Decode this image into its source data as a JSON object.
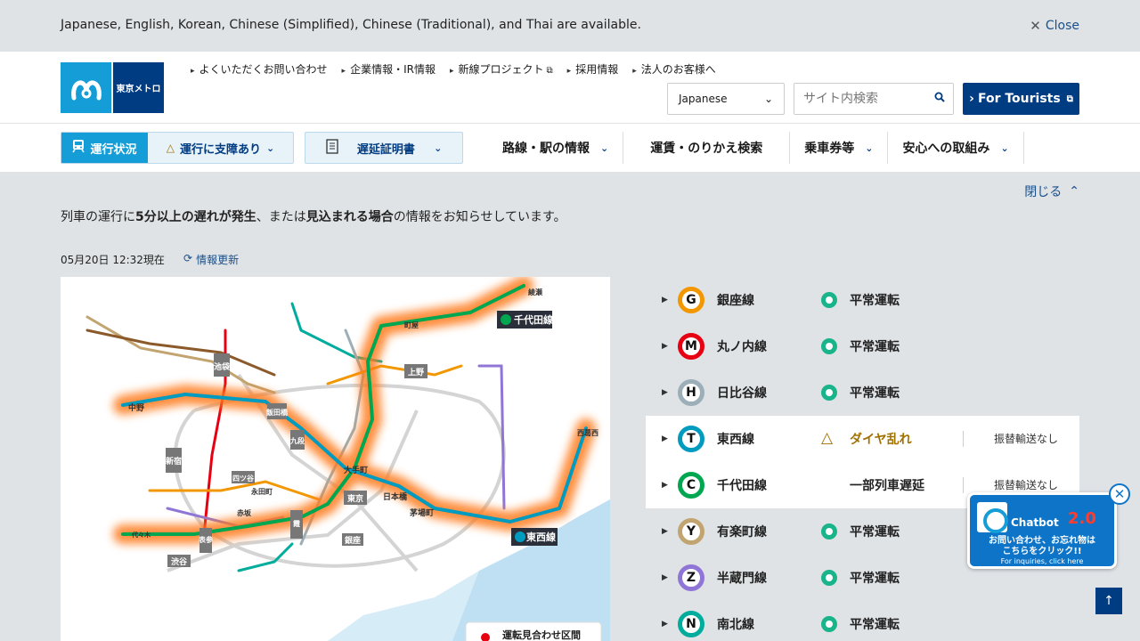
{
  "banner": {
    "message": "Japanese, English, Korean, Chinese (Simplified), Chinese (Traditional), and Thai are available.",
    "close_label": "Close"
  },
  "header": {
    "logo_text": "東京メトロ",
    "util_links": [
      "よくいただくお問い合わせ",
      "企業情報・IR情報",
      "新線プロジェクト",
      "採用情報",
      "法人のお客様へ"
    ],
    "language": "Japanese",
    "search_placeholder": "サイト内検索",
    "tourist_label": "For Tourists"
  },
  "nav": {
    "status_tag": "運行状況",
    "status_state": "運行に支障あり",
    "delay_cert": "遅延証明書",
    "items": [
      "路線・駅の情報",
      "運賃・のりかえ検索",
      "乗車券等",
      "安心への取組み"
    ]
  },
  "content": {
    "collapse_label": "閉じる",
    "notice_1": "列車の運行に",
    "notice_b1": "5分以上の遅れが発生",
    "notice_2": "、または",
    "notice_b2": "見込まれる場合",
    "notice_3": "の情報をお知らせしています。",
    "timestamp": "05月20日 12:32現在",
    "refresh_label": "情報更新"
  },
  "map": {
    "label_chiyoda": "千代田線",
    "label_tozai": "東西線",
    "legend": "運転見合わせ区間",
    "stations": [
      "池袋",
      "中野",
      "飯田橋",
      "九段下",
      "大手町",
      "東京",
      "日本橋",
      "茅場町",
      "新宿",
      "四ツ谷",
      "永田町",
      "赤坂",
      "表参道",
      "渋谷",
      "霞ケ関",
      "銀座",
      "上野",
      "町屋",
      "西葛西",
      "代々木公園",
      "綾瀬"
    ]
  },
  "lines": [
    {
      "letter": "G",
      "name": "銀座線",
      "status": "平常運転",
      "color": "#f39700",
      "alert": false,
      "extra": ""
    },
    {
      "letter": "M",
      "name": "丸ノ内線",
      "status": "平常運転",
      "color": "#e60012",
      "alert": false,
      "extra": ""
    },
    {
      "letter": "H",
      "name": "日比谷線",
      "status": "平常運転",
      "color": "#9caeb7",
      "alert": false,
      "extra": ""
    },
    {
      "letter": "T",
      "name": "東西線",
      "status": "ダイヤ乱れ",
      "color": "#009bbf",
      "alert": true,
      "extra": "振替輸送なし"
    },
    {
      "letter": "C",
      "name": "千代田線",
      "status": "一部列車遅延",
      "color": "#00a650",
      "alert": true,
      "extra": "振替輸送なし"
    },
    {
      "letter": "Y",
      "name": "有楽町線",
      "status": "平常運転",
      "color": "#c1a470",
      "alert": false,
      "extra": ""
    },
    {
      "letter": "Z",
      "name": "半蔵門線",
      "status": "平常運転",
      "color": "#8f76d6",
      "alert": false,
      "extra": ""
    },
    {
      "letter": "N",
      "name": "南北線",
      "status": "平常運転",
      "color": "#00ac9b",
      "alert": false,
      "extra": ""
    }
  ],
  "chatbot": {
    "title": "Chatbot",
    "version": "2.0",
    "sub_1": "お問い合わせ、お忘れ物は",
    "sub_2": "こちらをクリック!!",
    "en": "For inquiries, click here"
  }
}
